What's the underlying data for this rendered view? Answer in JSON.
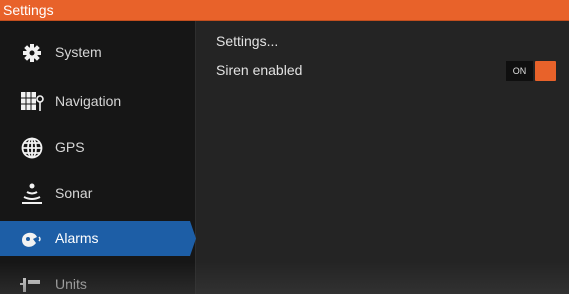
{
  "window": {
    "title": "Settings"
  },
  "sidebar": {
    "items": [
      {
        "label": "System",
        "icon": "gear-icon",
        "active": false
      },
      {
        "label": "Navigation",
        "icon": "navigation-icon",
        "active": false
      },
      {
        "label": "GPS",
        "icon": "globe-icon",
        "active": false
      },
      {
        "label": "Sonar",
        "icon": "sonar-icon",
        "active": false
      },
      {
        "label": "Alarms",
        "icon": "alarm-icon",
        "active": true
      },
      {
        "label": "Units",
        "icon": "units-icon",
        "active": false
      }
    ]
  },
  "main": {
    "settings_label": "Settings...",
    "siren": {
      "label": "Siren enabled",
      "toggle_state": "ON"
    }
  },
  "colors": {
    "accent": "#e8622a",
    "active_item": "#1d5ea6",
    "sidebar_bg": "#161616",
    "content_bg": "#242424"
  }
}
